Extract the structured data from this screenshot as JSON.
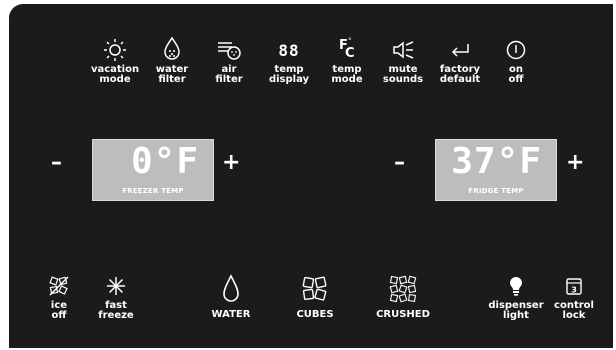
{
  "top_controls": [
    {
      "icon": "sun-icon",
      "line1": "vacation",
      "line2": "mode"
    },
    {
      "icon": "water-drop-filter-icon",
      "line1": "water",
      "line2": "filter"
    },
    {
      "icon": "air-filter-icon",
      "line1": "air",
      "line2": "filter"
    },
    {
      "icon": "segment-88-icon",
      "line1": "temp",
      "line2": "display"
    },
    {
      "icon": "fahrenheit-celsius-icon",
      "line1": "temp",
      "line2": "mode"
    },
    {
      "icon": "mute-speaker-icon",
      "line1": "mute",
      "line2": "sounds"
    },
    {
      "icon": "return-arrow-icon",
      "line1": "factory",
      "line2": "default"
    },
    {
      "icon": "power-icon",
      "line1": "on",
      "line2": "off"
    }
  ],
  "segment_icon_text": "88",
  "fc_icon": {
    "f": "F",
    "c": "C"
  },
  "freezer": {
    "minus": "–",
    "plus": "+",
    "value": "0°F",
    "label": "FREEZER TEMP"
  },
  "fridge": {
    "minus": "–",
    "plus": "+",
    "value": "37°F",
    "label": "FRIDGE TEMP"
  },
  "bottom_left": [
    {
      "icon": "ice-off-icon",
      "line1": "ice",
      "line2": "off"
    },
    {
      "icon": "snowflake-icon",
      "line1": "fast",
      "line2": "freeze"
    }
  ],
  "dispense": [
    {
      "icon": "water-drop-icon",
      "label": "WATER"
    },
    {
      "icon": "ice-cubes-icon",
      "label": "CUBES"
    },
    {
      "icon": "crushed-ice-icon",
      "label": "CRUSHED"
    }
  ],
  "bottom_right": [
    {
      "icon": "light-bulb-icon",
      "line1": "dispenser",
      "line2": "light"
    },
    {
      "icon": "lock-icon",
      "line1": "control",
      "line2": "lock",
      "icon_text": "3"
    }
  ],
  "colors": {
    "panel": "#1b1b1b",
    "text": "#ffffff",
    "lcd": "#bdbdbd"
  }
}
